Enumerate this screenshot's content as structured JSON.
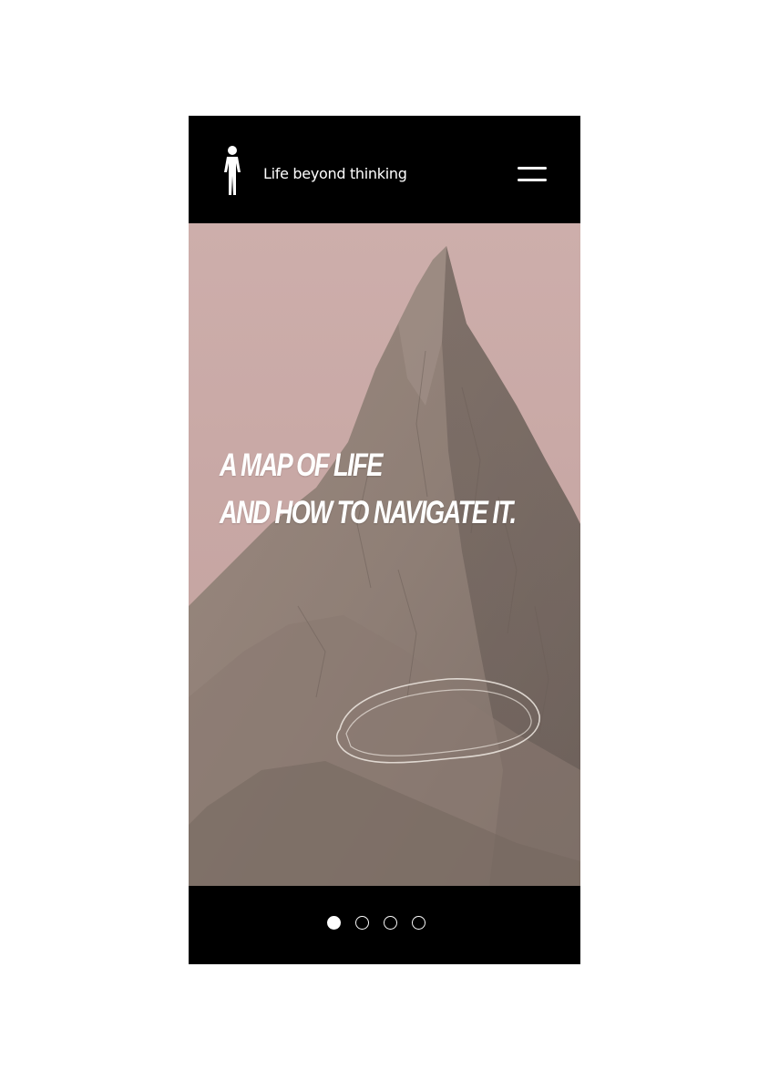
{
  "header": {
    "brand_text": "Life beyond thinking",
    "logo_icon": "person-standing-icon",
    "menu_icon": "hamburger-menu-icon"
  },
  "hero": {
    "headline_line1": "A MAP OF LIFE",
    "headline_line2": "AND HOW TO NAVIGATE IT.",
    "background": "mountain-peak-photo",
    "overlay": "hand-drawn-outline-loop"
  },
  "pagination": {
    "total": 4,
    "active_index": 0
  },
  "colors": {
    "bar": "#000000",
    "sky": "#c9a9a6",
    "text": "#ffffff"
  }
}
